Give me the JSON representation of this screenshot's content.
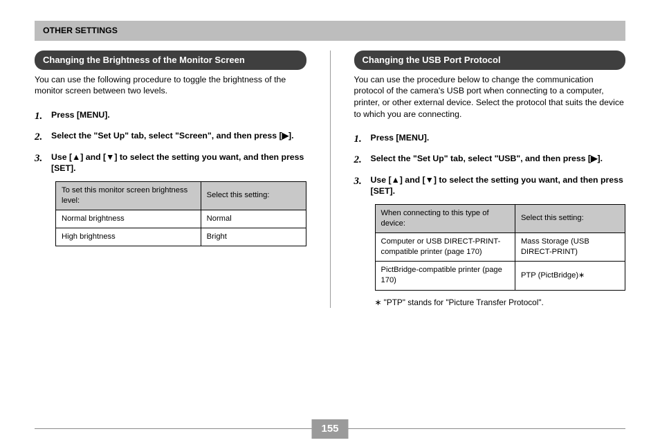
{
  "section_header": "OTHER SETTINGS",
  "page_number": "155",
  "left": {
    "title": "Changing the Brightness of the Monitor Screen",
    "intro": "You can use the following procedure to toggle the brightness of the monitor screen between two levels.",
    "steps": [
      {
        "n": "1.",
        "text_parts": [
          "Press [MENU]."
        ]
      },
      {
        "n": "2.",
        "text_parts": [
          "Select the \"Set Up\" tab, select \"Screen\", and then press [",
          "▶",
          "]."
        ]
      },
      {
        "n": "3.",
        "text_parts": [
          "Use [",
          "▲",
          "] and [",
          "▼",
          "] to select the setting you want, and then press [SET]."
        ]
      }
    ],
    "table": {
      "head": [
        "To set this monitor screen brightness level:",
        "Select this setting:"
      ],
      "rows": [
        [
          "Normal brightness",
          "Normal"
        ],
        [
          "High brightness",
          "Bright"
        ]
      ]
    }
  },
  "right": {
    "title": "Changing the USB Port Protocol",
    "intro": "You can use the procedure below to change the communication protocol of the camera's USB port when connecting to a computer, printer, or other external device. Select the protocol that suits the device to which you are connecting.",
    "steps": [
      {
        "n": "1.",
        "text_parts": [
          "Press [MENU]."
        ]
      },
      {
        "n": "2.",
        "text_parts": [
          "Select the \"Set Up\" tab, select \"USB\", and then press [",
          "▶",
          "]."
        ]
      },
      {
        "n": "3.",
        "text_parts": [
          "Use [",
          "▲",
          "] and [",
          "▼",
          "] to select the setting you want, and then press [SET]."
        ]
      }
    ],
    "table": {
      "head": [
        "When connecting to this type of device:",
        "Select this setting:"
      ],
      "rows": [
        [
          "Computer or USB DIRECT-PRINT-compatible printer (page 170)",
          "Mass Storage (USB DIRECT-PRINT)"
        ],
        [
          "PictBridge-compatible printer (page 170)",
          "PTP (PictBridge)∗"
        ]
      ]
    },
    "footnote": "∗ \"PTP\" stands for \"Picture Transfer Protocol\"."
  }
}
